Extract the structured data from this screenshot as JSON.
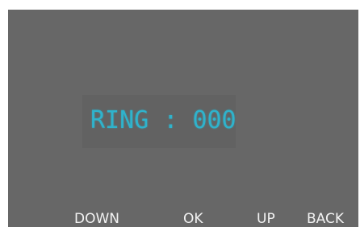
{
  "display": {
    "ring_label": "RING",
    "separator": ":",
    "ring_value": "000",
    "text_color": "#2fb3cc",
    "background_color": "#676767"
  },
  "softkeys": {
    "down": "DOWN",
    "ok": "OK",
    "up": "UP",
    "back": "BACK"
  }
}
